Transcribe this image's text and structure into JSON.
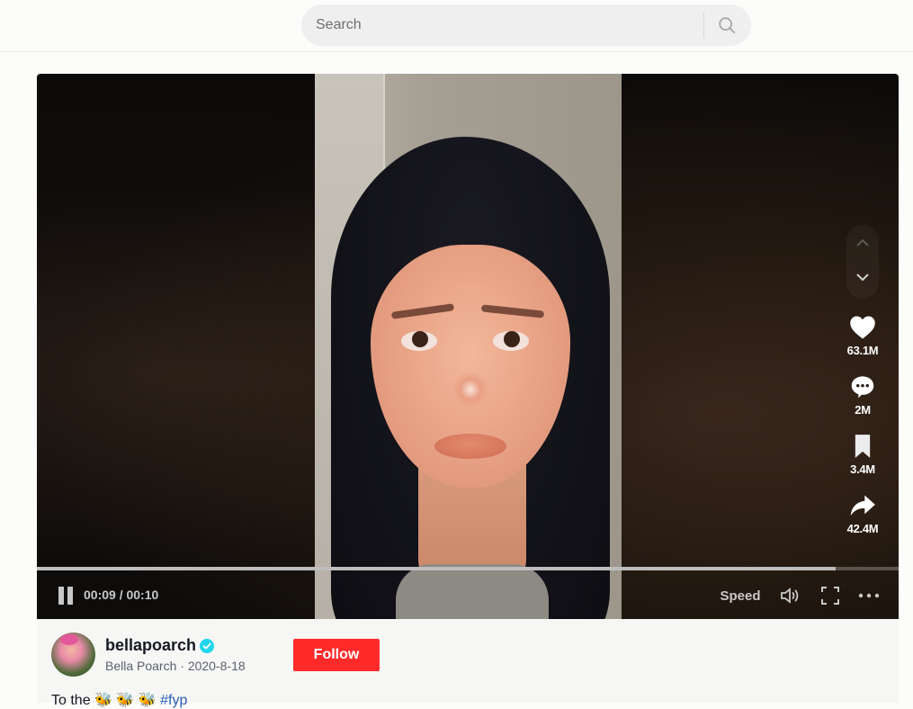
{
  "search": {
    "placeholder": "Search",
    "icon": "search-icon"
  },
  "player": {
    "current_time": "00:09",
    "duration": "00:10",
    "time_display": "00:09 / 00:10",
    "progress_fraction": 0.927,
    "state": "playing",
    "speed_label": "Speed",
    "icons": {
      "pause": "pause-icon",
      "volume": "volume-icon",
      "fullscreen": "fullscreen-icon",
      "more": "more-icon",
      "prev": "chevron-up-icon",
      "next": "chevron-down-icon"
    }
  },
  "actions": {
    "likes": "63.1M",
    "comments": "2M",
    "saves": "3.4M",
    "shares": "42.4M"
  },
  "author": {
    "username": "bellapoarch",
    "verified": true,
    "display_name": "Bella Poarch",
    "date": "2020-8-18",
    "subline": "Bella Poarch · 2020-8-18",
    "follow_label": "Follow"
  },
  "caption": {
    "text": "To the 🐝 🐝 🐝",
    "hashtag": "#fyp"
  },
  "colors": {
    "follow": "#ff2b2b",
    "verified": "#20d5ec",
    "hashtag": "#2b5db9",
    "progress_fill": "#bdbdbd"
  }
}
